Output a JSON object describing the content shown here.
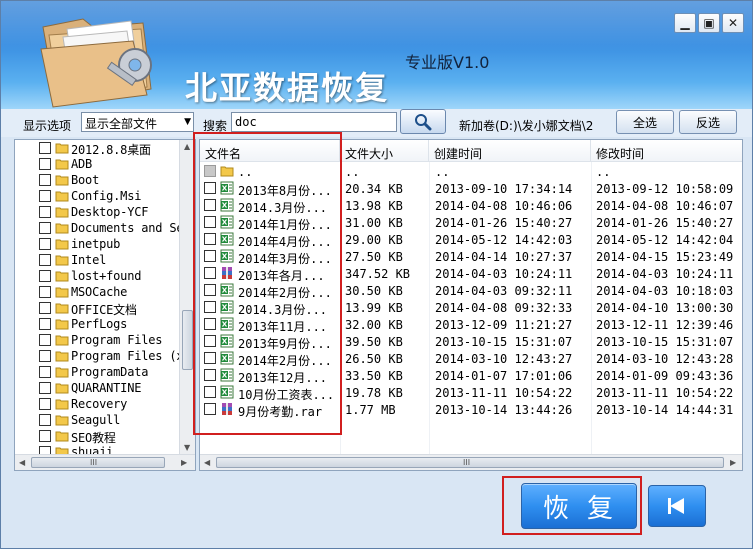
{
  "app": {
    "title": "北亚数据恢复",
    "version": "专业版V1.0"
  },
  "window_controls": {
    "minimize": "▁",
    "maximize": "▣",
    "close": "✕"
  },
  "toolbar": {
    "display_option_label": "显示选项",
    "display_option_value": "显示全部文件",
    "search_label": "搜索",
    "search_value": "doc",
    "path": "新加卷(D:)\\发小娜文档\\2",
    "select_all_label": "全选",
    "invert_label": "反选"
  },
  "tree": {
    "items": [
      "2012.8.8桌面",
      "ADB",
      "Boot",
      "Config.Msi",
      "Desktop-YCF",
      "Documents and Se",
      "inetpub",
      "Intel",
      "lost+found",
      "MSOCache",
      "OFFICE文档",
      "PerfLogs",
      "Program Files",
      "Program Files (x",
      "ProgramData",
      "QUARANTINE",
      "Recovery",
      "Seagull",
      "SEO教程",
      "shuaji"
    ]
  },
  "files": {
    "columns": [
      "文件名",
      "文件大小",
      "创建时间",
      "修改时间"
    ],
    "rows": [
      {
        "type": "up",
        "name": "..",
        "size": "..",
        "created": "..",
        "modified": ".."
      },
      {
        "type": "xls",
        "name": "2013年8月份...",
        "size": "20.34 KB",
        "created": "2013-09-10 17:34:14",
        "modified": "2013-09-12 10:58:09"
      },
      {
        "type": "xls",
        "name": "2014.3月份...",
        "size": "13.98 KB",
        "created": "2014-04-08 10:46:06",
        "modified": "2014-04-08 10:46:07"
      },
      {
        "type": "xls",
        "name": "2014年1月份...",
        "size": "31.00 KB",
        "created": "2014-01-26 15:40:27",
        "modified": "2014-01-26 15:40:27"
      },
      {
        "type": "xls",
        "name": "2014年4月份...",
        "size": "29.00 KB",
        "created": "2014-05-12 14:42:03",
        "modified": "2014-05-12 14:42:04"
      },
      {
        "type": "xls",
        "name": "2014年3月份...",
        "size": "27.50 KB",
        "created": "2014-04-14 10:27:37",
        "modified": "2014-04-15 15:23:49"
      },
      {
        "type": "rar",
        "name": "2013年各月...",
        "size": "347.52 KB",
        "created": "2014-04-03 10:24:11",
        "modified": "2014-04-03 10:24:11"
      },
      {
        "type": "xls",
        "name": "2014年2月份...",
        "size": "30.50 KB",
        "created": "2014-04-03 09:32:11",
        "modified": "2014-04-03 10:18:03"
      },
      {
        "type": "xls",
        "name": "2014.3月份...",
        "size": "13.99 KB",
        "created": "2014-04-08 09:32:33",
        "modified": "2014-04-10 13:00:30"
      },
      {
        "type": "xls",
        "name": "2013年11月...",
        "size": "32.00 KB",
        "created": "2013-12-09 11:21:27",
        "modified": "2013-12-11 12:39:46"
      },
      {
        "type": "xls",
        "name": "2013年9月份...",
        "size": "39.50 KB",
        "created": "2013-10-15 15:31:07",
        "modified": "2013-10-15 15:31:07"
      },
      {
        "type": "xls",
        "name": "2014年2月份...",
        "size": "26.50 KB",
        "created": "2014-03-10 12:43:27",
        "modified": "2014-03-10 12:43:28"
      },
      {
        "type": "xls",
        "name": "2013年12月...",
        "size": "33.50 KB",
        "created": "2014-01-07 17:01:06",
        "modified": "2014-01-09 09:43:36"
      },
      {
        "type": "xls",
        "name": "10月份工资表...",
        "size": "19.78 KB",
        "created": "2013-11-11 10:54:22",
        "modified": "2013-11-11 10:54:22"
      },
      {
        "type": "rar",
        "name": "9月份考勤.rar",
        "size": "1.77 MB",
        "created": "2013-10-14 13:44:26",
        "modified": "2013-10-14 14:44:31"
      }
    ]
  },
  "scroll": {
    "up": "▲",
    "down": "▼",
    "left": "◀",
    "right": "▶",
    "grip": "III"
  },
  "actions": {
    "restore_label": "恢复"
  },
  "colors": {
    "header_blue": "#3a8fe2",
    "highlight_red": "#d11f1f",
    "button_blue": "#2f8ff0",
    "excel_green": "#1f8a3a"
  }
}
